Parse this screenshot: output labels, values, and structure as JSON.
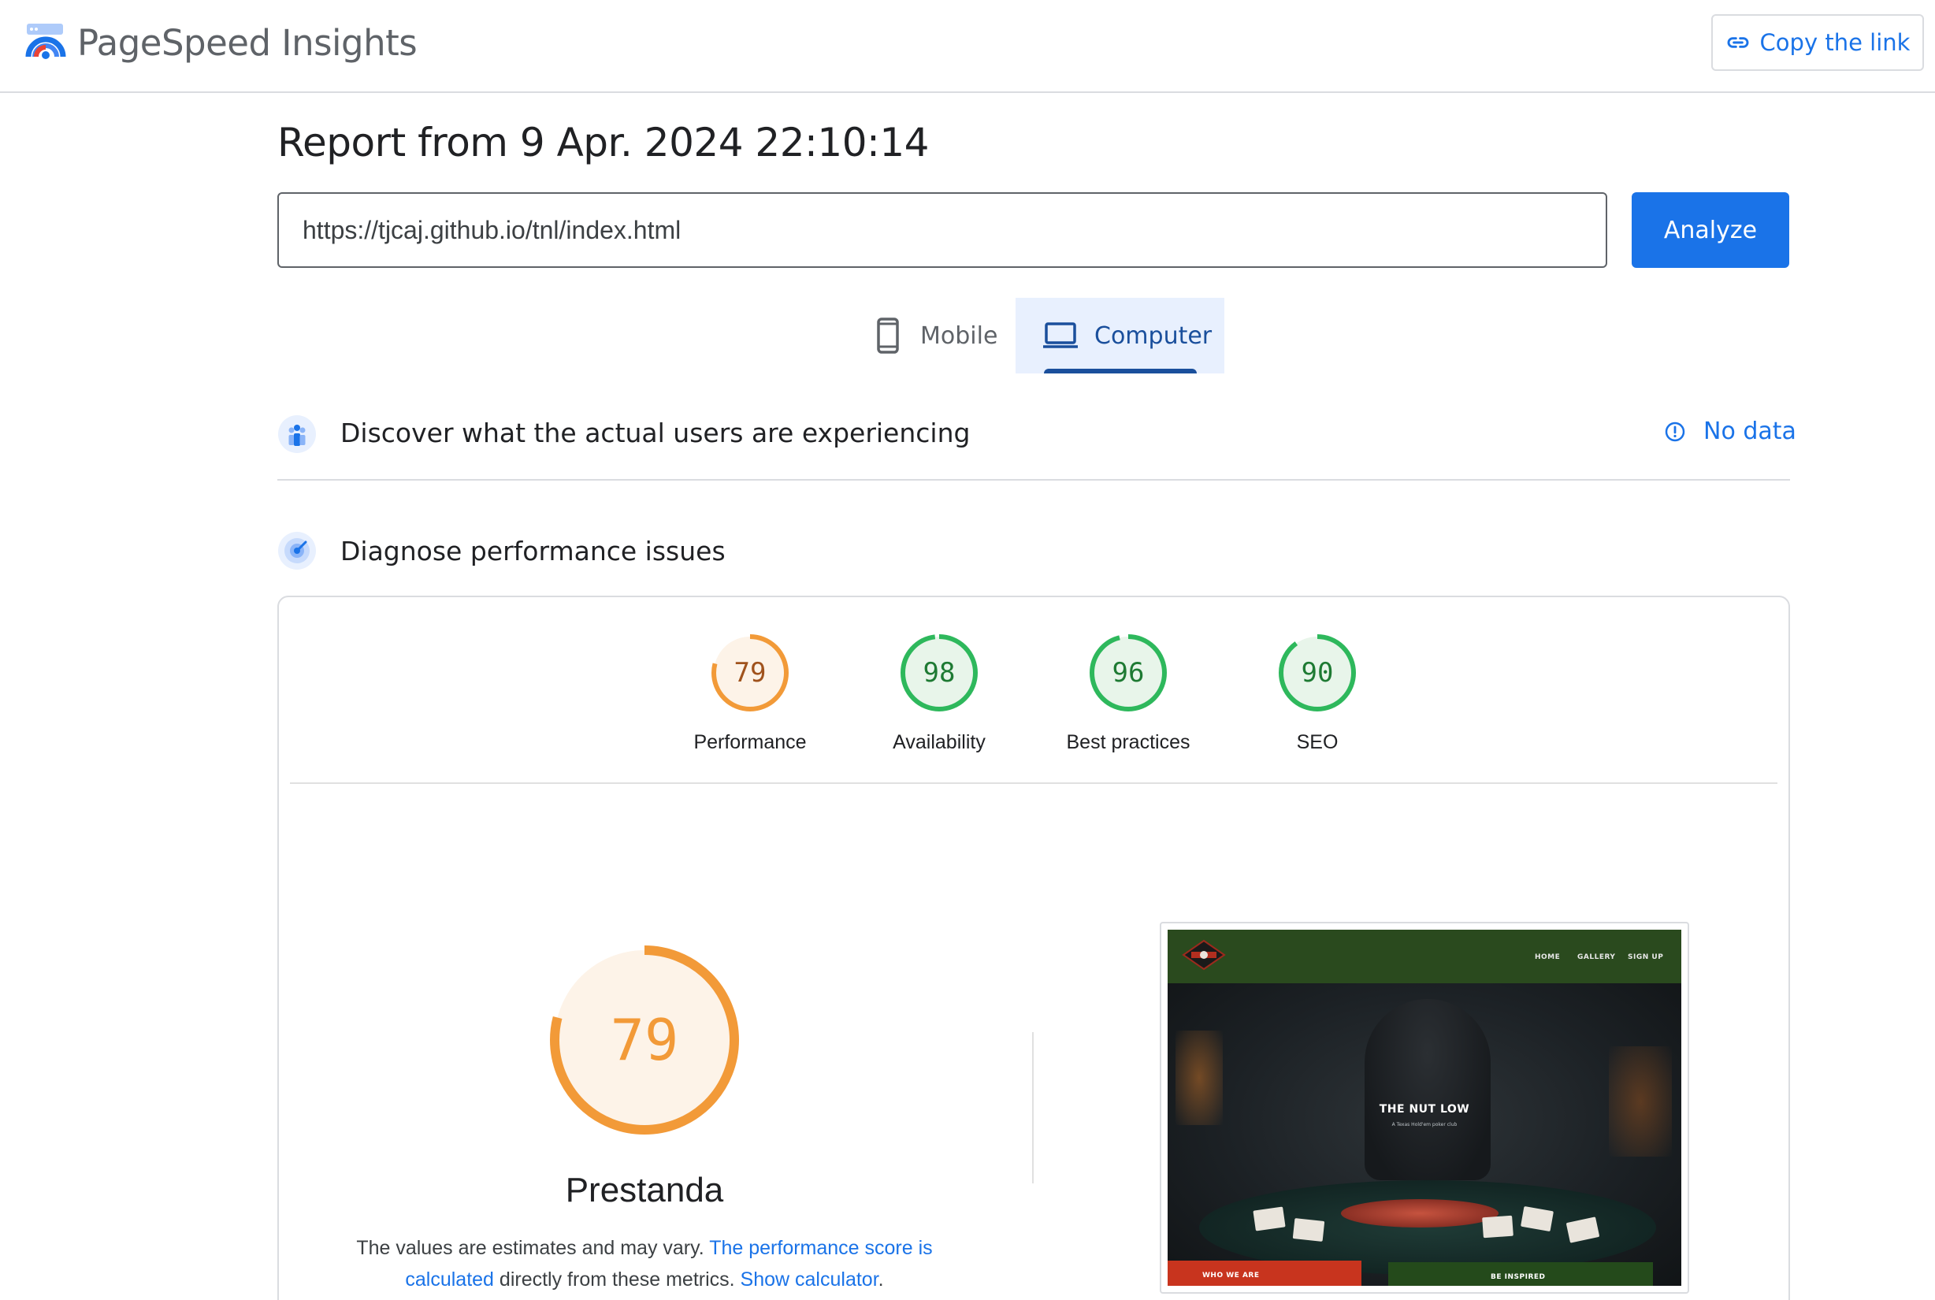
{
  "header": {
    "app_title": "PageSpeed Insights",
    "copy_link_label": "Copy the link"
  },
  "report": {
    "title": "Report from 9 Apr. 2024 22:10:14",
    "url_value": "https://tjcaj.github.io/tnl/index.html",
    "analyze_label": "Analyze"
  },
  "tabs": [
    {
      "label": "Mobile",
      "icon": "smartphone-icon",
      "active": false
    },
    {
      "label": "Computer",
      "icon": "laptop-icon",
      "active": true
    }
  ],
  "sections": {
    "field_data": {
      "title": "Discover what the actual users are experiencing",
      "status": "No data"
    },
    "diagnose": {
      "title": "Diagnose performance issues"
    }
  },
  "scores": [
    {
      "label": "Performance",
      "value": "79",
      "color": "#f29a38",
      "fill": "#fdf3e8",
      "text_color": "#a0521c"
    },
    {
      "label": "Availability",
      "value": "98",
      "color": "#2eb85c",
      "fill": "#e8f5ea",
      "text_color": "#1e7a33"
    },
    {
      "label": "Best practices",
      "value": "96",
      "color": "#2eb85c",
      "fill": "#e8f5ea",
      "text_color": "#1e7a33"
    },
    {
      "label": "SEO",
      "value": "90",
      "color": "#2eb85c",
      "fill": "#e8f5ea",
      "text_color": "#1e7a33"
    }
  ],
  "performance_detail": {
    "score": "79",
    "title": "Prestanda",
    "note_prefix": "The values are estimates and may vary. ",
    "note_link1": "The performance score is calculated",
    "note_middle": " directly from these metrics. ",
    "note_link2": "Show calculator",
    "note_suffix": "."
  },
  "preview": {
    "nav_links": [
      "HOME",
      "GALLERY",
      "SIGN UP"
    ],
    "hero_title": "THE NUT LOW",
    "hero_subtitle": "A Texas Hold'em poker club",
    "band_left": "WHO WE ARE",
    "band_right": "BE INSPIRED"
  },
  "colors": {
    "accent": "#1a73e8",
    "tab_active_bg": "#e8f0fe",
    "average": "#f29a38",
    "pass": "#2eb85c"
  }
}
